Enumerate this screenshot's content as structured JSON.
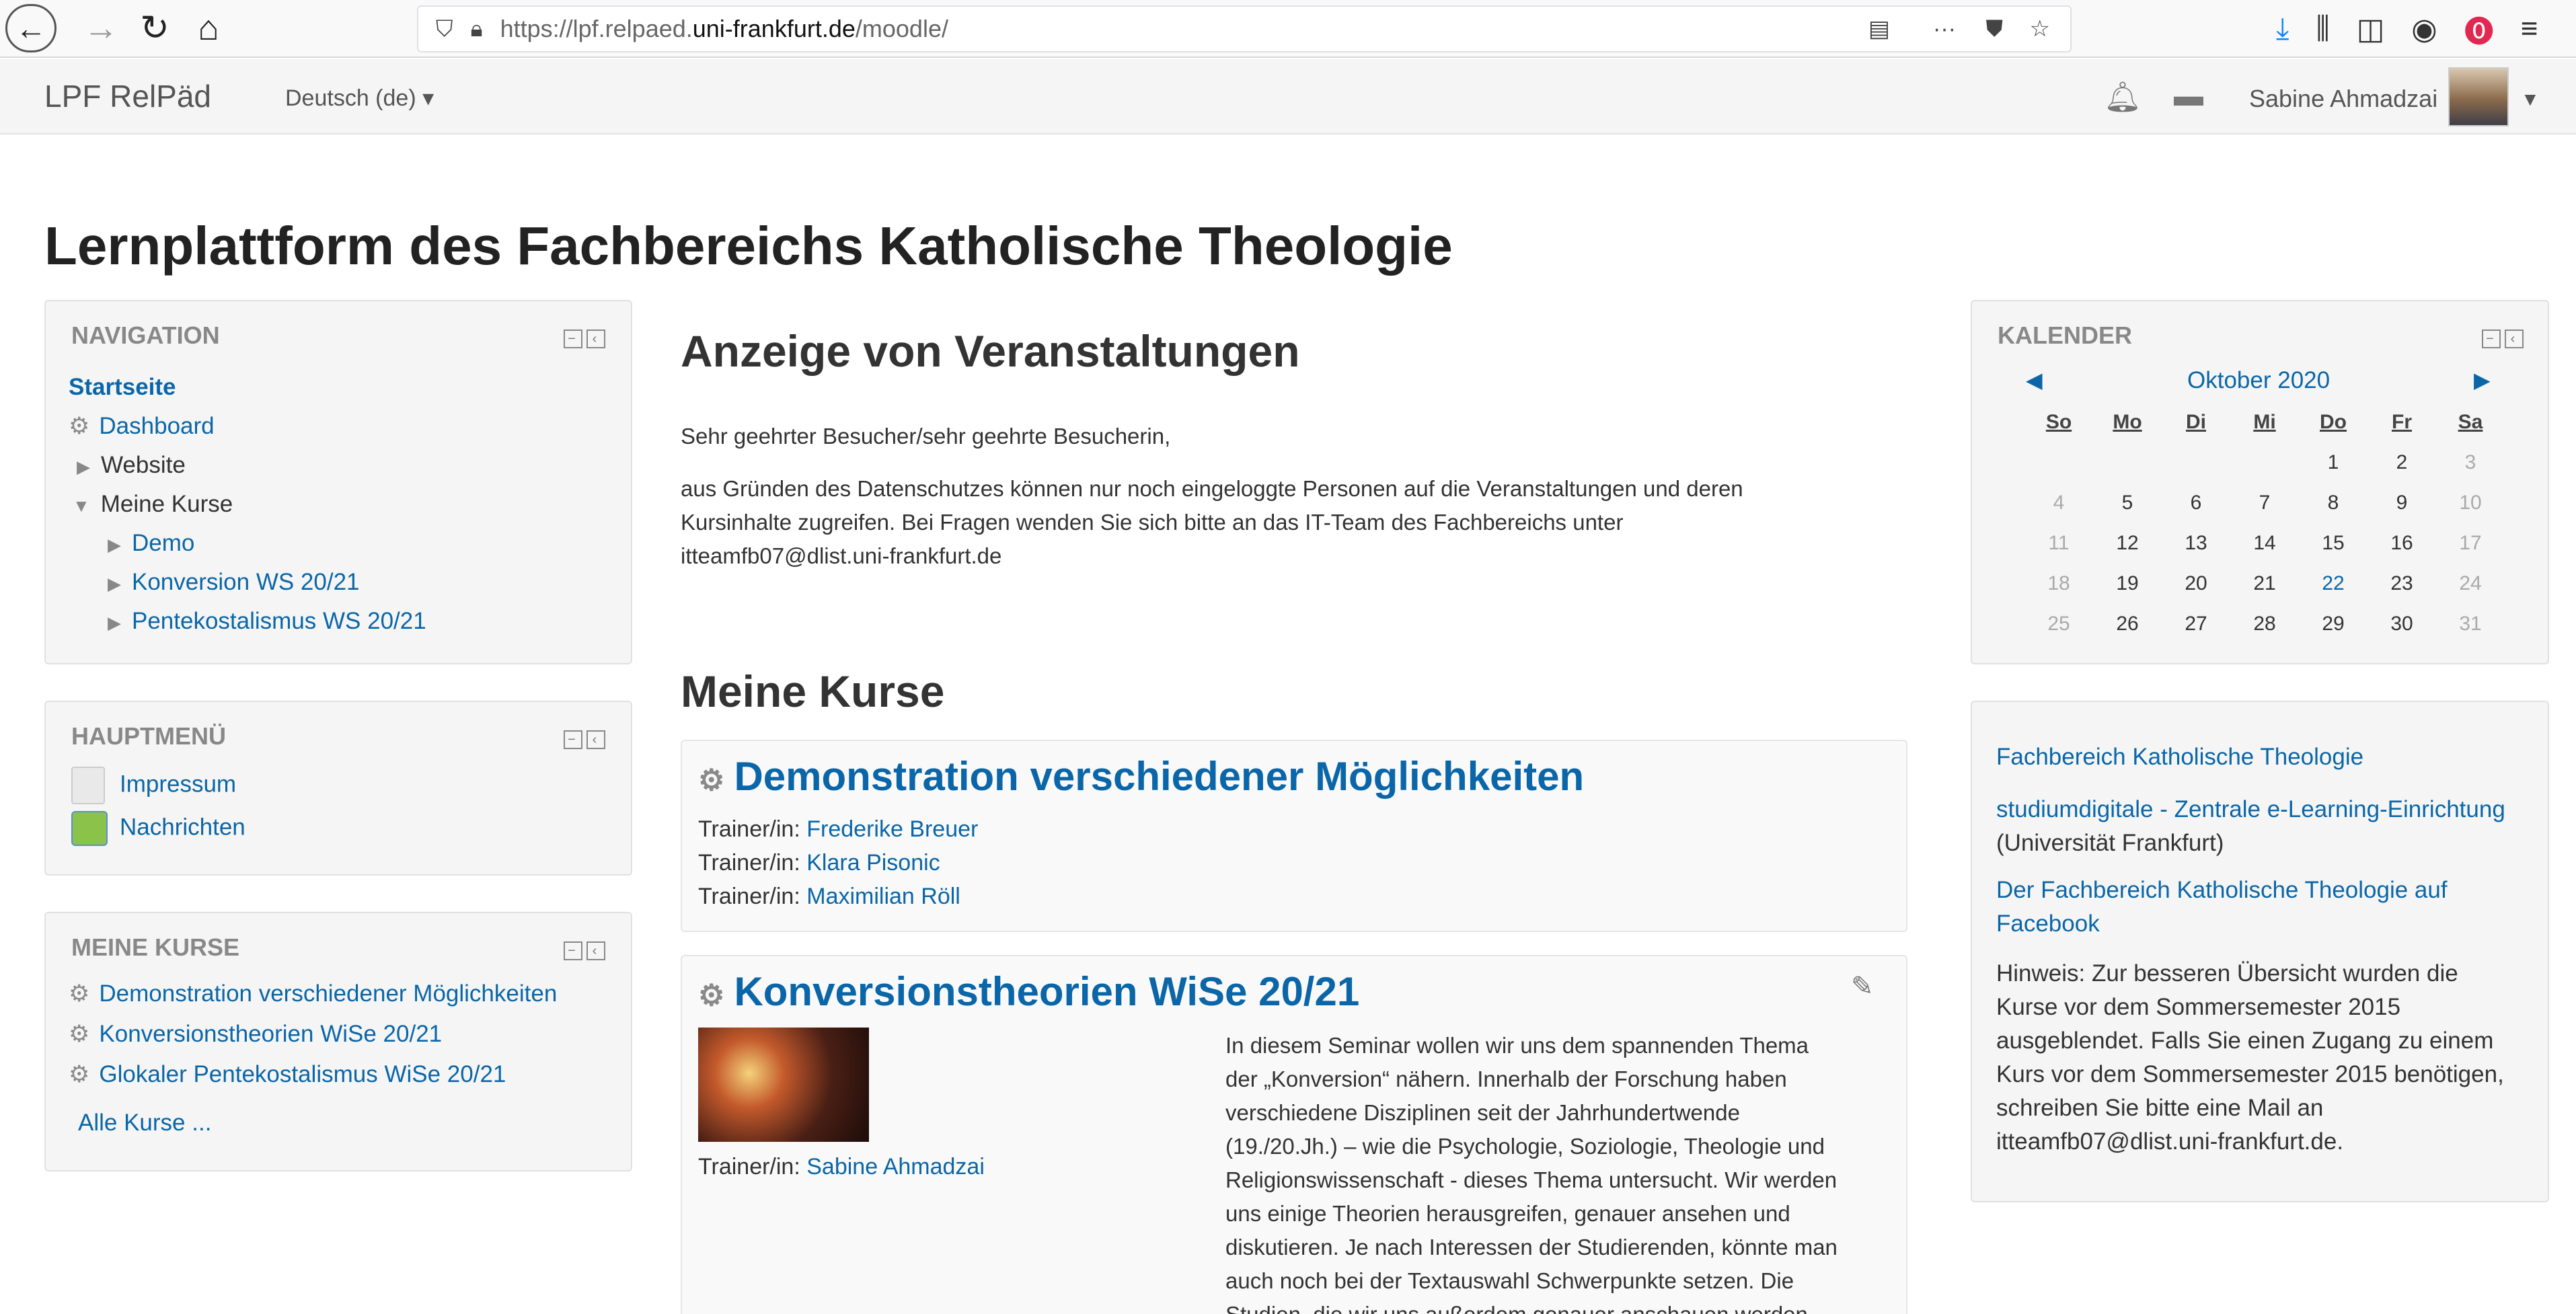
{
  "browser": {
    "url_prefix": "https://lpf.relpaed.",
    "url_domain": "uni-frankfurt.de",
    "url_path": "/moodle/",
    "icons": [
      "back-icon",
      "forward-icon",
      "reload-icon",
      "home-icon",
      "shield-icon",
      "lock-icon",
      "reader-icon",
      "more-icon",
      "pocket-icon",
      "bookmark-star-icon",
      "download-icon",
      "library-icon",
      "sidebar-icon",
      "account-icon",
      "extension-icon",
      "menu-icon"
    ]
  },
  "navbar": {
    "brand": "LPF RelPäd",
    "language": "Deutsch (de) ▾",
    "username": "Sabine Ahmadzai"
  },
  "page_title": "Lernplattform des Fachbereichs Katholische Theologie",
  "navigation": {
    "title": "NAVIGATION",
    "items": [
      {
        "label": "Startseite"
      },
      {
        "label": "Dashboard"
      },
      {
        "label": "Website"
      },
      {
        "label": "Meine Kurse"
      },
      {
        "label": "Demo"
      },
      {
        "label": "Konversion WS 20/21"
      },
      {
        "label": "Pentekostalismus WS 20/21"
      }
    ]
  },
  "mainmenu": {
    "title": "HAUPTMENÜ",
    "items": [
      {
        "label": "Impressum"
      },
      {
        "label": "Nachrichten"
      }
    ]
  },
  "mycourses_block": {
    "title": "MEINE KURSE",
    "items": [
      {
        "label": "Demonstration verschiedener Möglichkeiten"
      },
      {
        "label": "Konversionstheorien WiSe 20/21"
      },
      {
        "label": "Glokaler Pentekostalismus WiSe 20/21"
      }
    ],
    "all_courses": "Alle Kurse ..."
  },
  "events": {
    "heading": "Anzeige von Veranstaltungen",
    "greeting": "Sehr geehrter Besucher/sehr geehrte Besucherin,",
    "line1": "aus Gründen des Datenschutzes können nur noch eingeloggte Personen auf die Veranstaltungen und deren",
    "line2": "Kursinhalte zugreifen. Bei Fragen wenden Sie sich bitte an das IT-Team des Fachbereichs unter",
    "line3": "itteamfb07@dlist.uni-frankfurt.de"
  },
  "my_courses": {
    "heading": "Meine Kurse",
    "trainer_label": "Trainer/in:",
    "course1": {
      "title": "Demonstration verschiedener Möglichkeiten",
      "trainers": [
        "Frederike Breuer",
        "Klara Pisonic",
        "Maximilian Röll"
      ]
    },
    "course2": {
      "title": "Konversionstheorien WiSe 20/21",
      "trainer": "Sabine Ahmadzai",
      "summary_lines": [
        "In diesem Seminar wollen wir uns dem spannenden Thema",
        "der „Konversion“ nähern. Innerhalb der Forschung haben",
        "verschiedene Disziplinen seit der Jahrhundertwende",
        "(19./20.Jh.) – wie die Psychologie, Soziologie, Theologie und",
        "Religionswissenschaft - dieses Thema untersucht. Wir werden",
        "uns einige Theorien herausgreifen, genauer ansehen und",
        "diskutieren. Je nach Interessen der Studierenden, könnte man",
        "auch noch bei der Textauswahl Schwerpunkte setzen. Die",
        "Studien, die wir uns außerdem genauer anschauen werden,"
      ]
    }
  },
  "calendar": {
    "title": "KALENDER",
    "month": "Oktober 2020",
    "weekdays": [
      "So",
      "Mo",
      "Di",
      "Mi",
      "Do",
      "Fr",
      "Sa"
    ],
    "weeks": [
      [
        "",
        "",
        "",
        "",
        "1",
        "2",
        "3"
      ],
      [
        "4",
        "5",
        "6",
        "7",
        "8",
        "9",
        "10"
      ],
      [
        "11",
        "12",
        "13",
        "14",
        "15",
        "16",
        "17"
      ],
      [
        "18",
        "19",
        "20",
        "21",
        "22",
        "23",
        "24"
      ],
      [
        "25",
        "26",
        "27",
        "28",
        "29",
        "30",
        "31"
      ]
    ],
    "highlight_day": "22"
  },
  "links_block": {
    "link1": "Fachbereich Katholische Theologie",
    "link2": "studiumdigitale - Zentrale e-Learning-Einrichtung",
    "link2_suffix": "(Universität Frankfurt)",
    "link3_line1": "Der Fachbereich Katholische Theologie auf",
    "link3_line2": "Facebook",
    "note_lines": [
      "Hinweis: Zur besseren Übersicht wurden die",
      "Kurse vor dem Sommersemester 2015",
      "ausgeblendet. Falls Sie einen Zugang zu einem",
      "Kurs vor dem Sommersemester 2015 benötigen,",
      "schreiben Sie bitte eine Mail an",
      "itteamfb07@dlist.uni-frankfurt.de."
    ]
  },
  "colors": {
    "link": "#0a66a8",
    "block_bg": "#f5f5f5"
  }
}
